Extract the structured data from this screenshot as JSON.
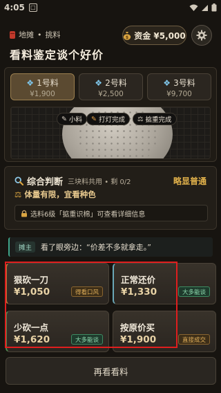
{
  "status_bar": {
    "time": "4:05",
    "box_glyph": "□"
  },
  "header": {
    "breadcrumb": [
      "地摊",
      "•",
      "挑料"
    ],
    "title": "看料鉴定谈个好价",
    "funds_label": "资金 ¥5,000"
  },
  "items": [
    {
      "label": "1号料",
      "price": "¥1,900"
    },
    {
      "label": "2号料",
      "price": "¥2,500"
    },
    {
      "label": "3号料",
      "price": "¥9,700"
    }
  ],
  "actions": [
    "小料",
    "打灯完成",
    "掂重完成"
  ],
  "analysis": {
    "title": "综合判断",
    "subtitle": "三块料共用 • 剩 0/2",
    "verdict": "略显普通",
    "hint": "体量有限，宜看种色",
    "locked_hint": "选料6级「掂重识棉」可查看详细信息"
  },
  "dialog": {
    "speaker": "摊主",
    "text": "看了眼旁边：“价差不多就拿走。”"
  },
  "choices": [
    {
      "name": "狠砍一刀",
      "price": "¥1,050",
      "tag": "得看口风"
    },
    {
      "name": "正常还价",
      "price": "¥1,330",
      "tag": "大多能谈"
    },
    {
      "name": "少砍一点",
      "price": "¥1,620",
      "tag": "大多能谈"
    },
    {
      "name": "按原价买",
      "price": "¥1,900",
      "tag": "直接成交"
    }
  ],
  "review_label": "再看看料",
  "colors": {
    "accent_gold": "#e0b04a",
    "highlight_red": "#e01e1e",
    "tag_green": "#8fdcb0",
    "tag_orange": "#e2b05a"
  },
  "icons": [
    "sd-card-icon",
    "wifi-icon",
    "signal-icon",
    "battery-icon",
    "red-stall-icon",
    "money-bag-icon",
    "gear-icon",
    "gem-icon",
    "pencil-icon",
    "flashlight-icon",
    "scale-icon",
    "magnifier-icon",
    "lock-icon"
  ]
}
